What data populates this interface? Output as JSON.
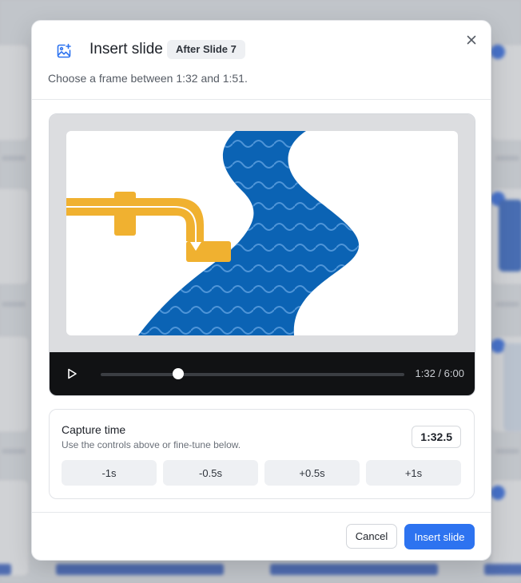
{
  "dialog": {
    "title": "Insert slide",
    "badge": "After Slide 7",
    "subtitle": "Choose a frame between 1:32 and 1:51."
  },
  "player": {
    "time_display": "1:32 / 6:00",
    "current_seconds": 92,
    "duration_seconds": 360
  },
  "capture": {
    "title": "Capture time",
    "help": "Use the controls above or fine-tune below.",
    "value": "1:32.5",
    "steps": [
      "-1s",
      "-0.5s",
      "+0.5s",
      "+1s"
    ]
  },
  "footer": {
    "cancel_label": "Cancel",
    "insert_label": "Insert slide"
  },
  "icons": {
    "header": "image-add-icon",
    "close": "close-icon",
    "play": "play-icon"
  },
  "colors": {
    "accent": "#2d73f0",
    "river": "#0b63b4",
    "pipe": "#f0b130",
    "controls_bg": "#111214"
  }
}
